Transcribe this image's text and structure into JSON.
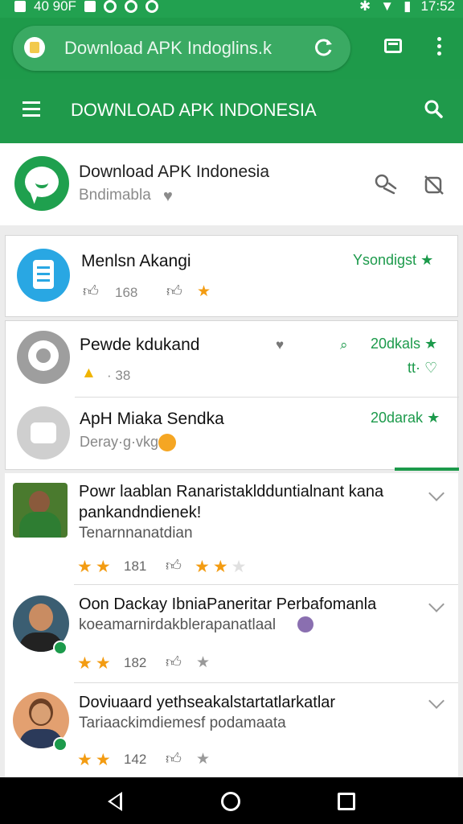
{
  "status_bar": {
    "left_text": "40 90F",
    "time": "17:52",
    "colors": {
      "bar": "#22a150"
    }
  },
  "browser": {
    "url": "Download APK Indoglins.k"
  },
  "appbar": {
    "title": "DOWNLOAD APK INDONESIA"
  },
  "header": {
    "title": "Download APK Indonesia",
    "subtitle": "Bndimabla"
  },
  "apps": [
    {
      "title": "Menlsn Akangi",
      "meta1": "168",
      "badge": "Ysondigst",
      "accent": "#29a7e3"
    },
    {
      "title": "Pewde kdukand",
      "meta1": "· 38",
      "badge": "20dkals",
      "badge2": "tt·",
      "accent": "#9e9e9e"
    },
    {
      "title": "ApH Miaka Sendka",
      "meta1": "Deray·g·vkg",
      "badge": "20darak",
      "accent": "#bdbdbd"
    }
  ],
  "reviews": [
    {
      "name": "Powr laablan Ranaristakldduntialnant kana",
      "name2": "pankandndienek!",
      "text": "Tenarnnanatdian",
      "rating": 2,
      "count": "181",
      "avatar_bg": "#4a7a2e"
    },
    {
      "name": "Oon Dackay IbniaPaneritar Perbafomanla",
      "text": "koeamarnirdakblerapanatlaal",
      "rating": 2,
      "count": "182",
      "avatar_bg": "#3b5e72"
    },
    {
      "name": "Doviuaard yethseakalstartatlarkatlar",
      "text": "Tariaackimdiemesf podamaata",
      "rating": 2,
      "count": "142",
      "avatar_bg": "#e3a070"
    }
  ],
  "theme": {
    "primary": "#1f9a4b",
    "star": "#f39c12"
  }
}
